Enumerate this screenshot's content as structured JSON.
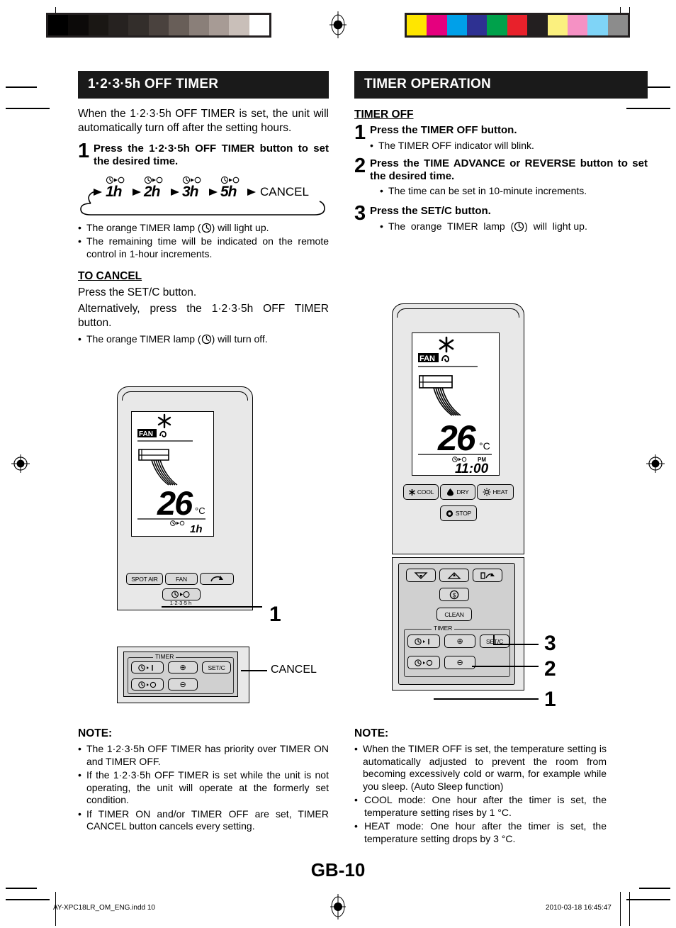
{
  "calibration": {
    "gray_bar": [
      "#000000",
      "#0c0a09",
      "#1a1714",
      "#262220",
      "#332e2b",
      "#4a423e",
      "#685e58",
      "#8a7f79",
      "#a79b95",
      "#c9bfb9",
      "#ffffff"
    ],
    "color_bar": [
      "#ffe600",
      "#e5007e",
      "#00a0e9",
      "#2e3192",
      "#00a14b",
      "#e8212b",
      "#231f20",
      "#fbf07f",
      "#f591c4",
      "#7fd4f7",
      "#8c8c8c"
    ]
  },
  "left_column": {
    "section_title": "1·2·3·5h OFF TIMER",
    "intro": "When the 1·2·3·5h OFF TIMER is set, the unit will automatically turn off after the setting hours.",
    "step1": {
      "num": "1",
      "text": "Press the 1·2·3·5h OFF TIMER button to set the desired time."
    },
    "cycle": {
      "items": [
        "1h",
        "2h",
        "3h",
        "5h"
      ],
      "cancel_label": "CANCEL",
      "icon_label": "timer-off-indicator"
    },
    "bullets": [
      "The orange TIMER lamp ( ) will light up.",
      "The remaining time will be indicated on the remote control in 1-hour increments."
    ],
    "cancel_head": "TO CANCEL",
    "cancel_line1": "Press the SET/C button.",
    "cancel_line2": "Alternatively, press the 1·2·3·5h OFF TIMER button.",
    "cancel_bullet": "The orange TIMER lamp ( ) will turn off.",
    "remote": {
      "lcd": {
        "mode_icon": "snowflake-icon",
        "fan_label": "FAN",
        "swing_icon": "swing-icon",
        "temperature": "26",
        "unit": "°C",
        "timer_icon": "timer-off-icon",
        "timer_value": "1h"
      },
      "buttons_row": [
        "SPOT AIR",
        "FAN",
        "swing-button"
      ],
      "timer_button_icon": "timer-off-icon",
      "timer_button_sub": "1·2·3·5 h",
      "callout_1": "1",
      "panel": {
        "group_label": "TIMER",
        "timer_on_icon": "timer-on-icon",
        "timer_off_icon": "timer-off-icon",
        "plus": "⊕",
        "minus": "⊖",
        "setc": "SET/C"
      },
      "callout_cancel": "CANCEL"
    },
    "note_head": "NOTE:",
    "notes": [
      "The 1·2·3·5h OFF TIMER has priority over TIMER ON and TIMER OFF.",
      "If the 1·2·3·5h OFF TIMER is set while the unit is not operating, the unit will operate at the formerly set condition.",
      "If TIMER ON and/or TIMER OFF are set, TIMER CANCEL button cancels every setting."
    ]
  },
  "right_column": {
    "section_title": "TIMER OPERATION",
    "subhead": "TIMER OFF ",
    "steps": [
      {
        "num": "1",
        "text": "Press the TIMER OFF button.",
        "bullets": [
          "The TIMER OFF indicator will blink."
        ]
      },
      {
        "num": "2",
        "text": "Press the TIME ADVANCE or REVERSE button to set the desired time.",
        "bullets": [
          "The time can be set in 10-minute increments."
        ]
      },
      {
        "num": "3",
        "text": "Press the SET/C button.",
        "bullets": [
          "The orange TIMER lamp ( ) will light up."
        ]
      }
    ],
    "remote": {
      "lcd": {
        "mode_icon": "snowflake-icon",
        "fan_label": "FAN",
        "swing_icon": "swing-icon",
        "temperature": "26",
        "unit": "°C",
        "timer_icon": "timer-off-icon",
        "pm_label": "PM",
        "clock": "11:00"
      },
      "mode_buttons": [
        "COOL",
        "DRY",
        "HEAT"
      ],
      "stop_button": "STOP",
      "lower_buttons": [
        "louver-down-icon",
        "louver-up-icon",
        "louver-swing-icon",
        "economy-icon"
      ],
      "clean_button": "CLEAN",
      "panel": {
        "group_label": "TIMER",
        "timer_on_icon": "timer-on-icon",
        "timer_off_icon": "timer-off-icon",
        "plus": "⊕",
        "minus": "⊖",
        "setc": "SET/C"
      },
      "callouts": [
        "3",
        "2",
        "1"
      ]
    },
    "note_head": "NOTE:",
    "notes": [
      "When the TIMER OFF is set, the temperature setting is automatically adjusted to prevent the room from becoming excessively cold or warm, for example while you sleep. (Auto Sleep function)",
      "COOL mode: One hour after the timer is set, the temperature setting rises by 1 °C.",
      "HEAT mode: One hour after the timer is set, the temperature setting drops by 3 °C."
    ]
  },
  "footer": {
    "page_number": "GB-10",
    "file_name": "AY-XPC18LR_OM_ENG.indd   10",
    "timestamp": "2010-03-18   16:45:47"
  }
}
